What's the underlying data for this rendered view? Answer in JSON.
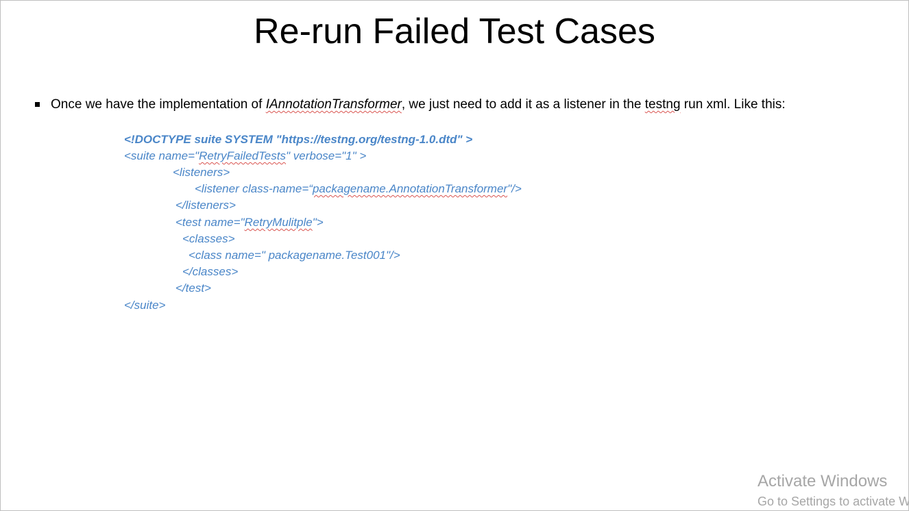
{
  "slide": {
    "title": "Re-run Failed Test Cases",
    "bullet": {
      "before": "Once we have the implementation of ",
      "class_name": "IAnnotationTransformer",
      "middle": ", we just need to add it as a listener in the ",
      "testng_word": "testng",
      "after": " run xml. Like this:"
    },
    "code": {
      "doctype": "<!DOCTYPE suite SYSTEM \"https://testng.org/testng-1.0.dtd\" >",
      "suite_open_a": "<suite name=\"",
      "suite_name": "RetryFailedTests",
      "suite_open_b": "\" verbose=\"1\" >",
      "listeners_open": "<listeners>",
      "listener_a": "<listener class-name=“",
      "listener_class": "packagename.AnnotationTransformer",
      "listener_b": "\"/>",
      "listeners_close": "</listeners>",
      "test_open_a": "<test name=\"",
      "test_name": "RetryMulitple",
      "test_open_b": "\">",
      "classes_open": "<classes>",
      "class_line": "<class name=\" packagename.Test001\"/>",
      "classes_close": "</classes>",
      "test_close": "</test>",
      "suite_close": "</suite>"
    }
  },
  "watermark": {
    "line1": "Activate Windows",
    "line2": "Go to Settings to activate W"
  },
  "colors": {
    "code": "#4a86c8",
    "text": "#000000",
    "watermark": "#a6a6a6",
    "spellcheck": "#d9534f"
  }
}
